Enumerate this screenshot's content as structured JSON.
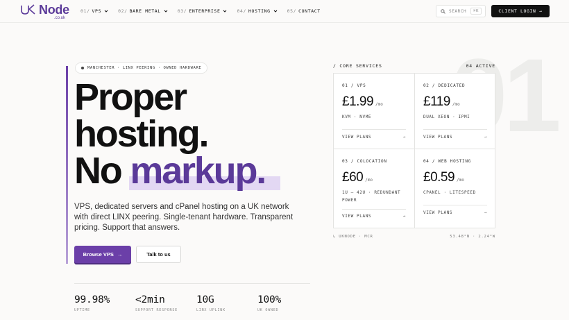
{
  "brand": {
    "name": "Node",
    "tld": ".co.uk"
  },
  "nav": {
    "items": [
      {
        "num": "01/",
        "label": "VPS",
        "chevron": true
      },
      {
        "num": "02/",
        "label": "BARE METAL",
        "chevron": true
      },
      {
        "num": "03/",
        "label": "ENTERPRISE",
        "chevron": true
      },
      {
        "num": "04/",
        "label": "HOSTING",
        "chevron": true
      },
      {
        "num": "05/",
        "label": "CONTACT",
        "chevron": false
      }
    ],
    "search_label": "SEARCH",
    "search_kbd": "⌘K",
    "login_label": "CLIENT LOGIN →"
  },
  "hero": {
    "badge": "MANCHESTER · LINX PEERING · OWNED HARDWARE",
    "headline_1": "Proper",
    "headline_2": "hosting.",
    "headline_3a": "No ",
    "headline_3b": "markup.",
    "lede": "VPS, dedicated servers and cPanel hosting on a UK network with direct LINX peering. Single-tenant hardware. Transparent pricing. Support that answers.",
    "primary_cta": "Browse VPS",
    "primary_arrow": "→",
    "secondary_cta": "Talk to us"
  },
  "stats": [
    {
      "value": "99.98%",
      "label": "UPTIME"
    },
    {
      "value": "<2min",
      "label": "SUPPORT RESPONSE"
    },
    {
      "value": "10G",
      "label": "LINX UPLINK"
    },
    {
      "value": "100%",
      "label": "UK OWNED"
    }
  ],
  "panel": {
    "big_number": "01",
    "title": "/ CORE SERVICES",
    "count": "04 ACTIVE",
    "services": [
      {
        "tag": "01 / VPS",
        "price": "£1.99",
        "per": "/mo",
        "spec": "KVM · NVME",
        "link": "VIEW PLANS",
        "arrow": "→"
      },
      {
        "tag": "02 / DEDICATED",
        "price": "£119",
        "per": "/mo",
        "spec": "DUAL XEON · IPMI",
        "link": "VIEW PLANS",
        "arrow": "→"
      },
      {
        "tag": "03 / COLOCATION",
        "price": "£60",
        "per": "/mo",
        "spec": "1U – 42U · REDUNDANT POWER",
        "link": "VIEW PLANS",
        "arrow": "→"
      },
      {
        "tag": "04 / WEB HOSTING",
        "price": "£0.59",
        "per": "/mo",
        "spec": "CPANEL · LITESPEED",
        "link": "VIEW PLANS",
        "arrow": "→"
      }
    ],
    "footer_left": "↳ UKNODE · MCR",
    "footer_right": "53.48°N · 2.24°W"
  },
  "colors": {
    "accent": "#6b3fa8",
    "accent_text": "#5b3a99",
    "highlight": "#e3d8f3",
    "dark": "#111111"
  }
}
